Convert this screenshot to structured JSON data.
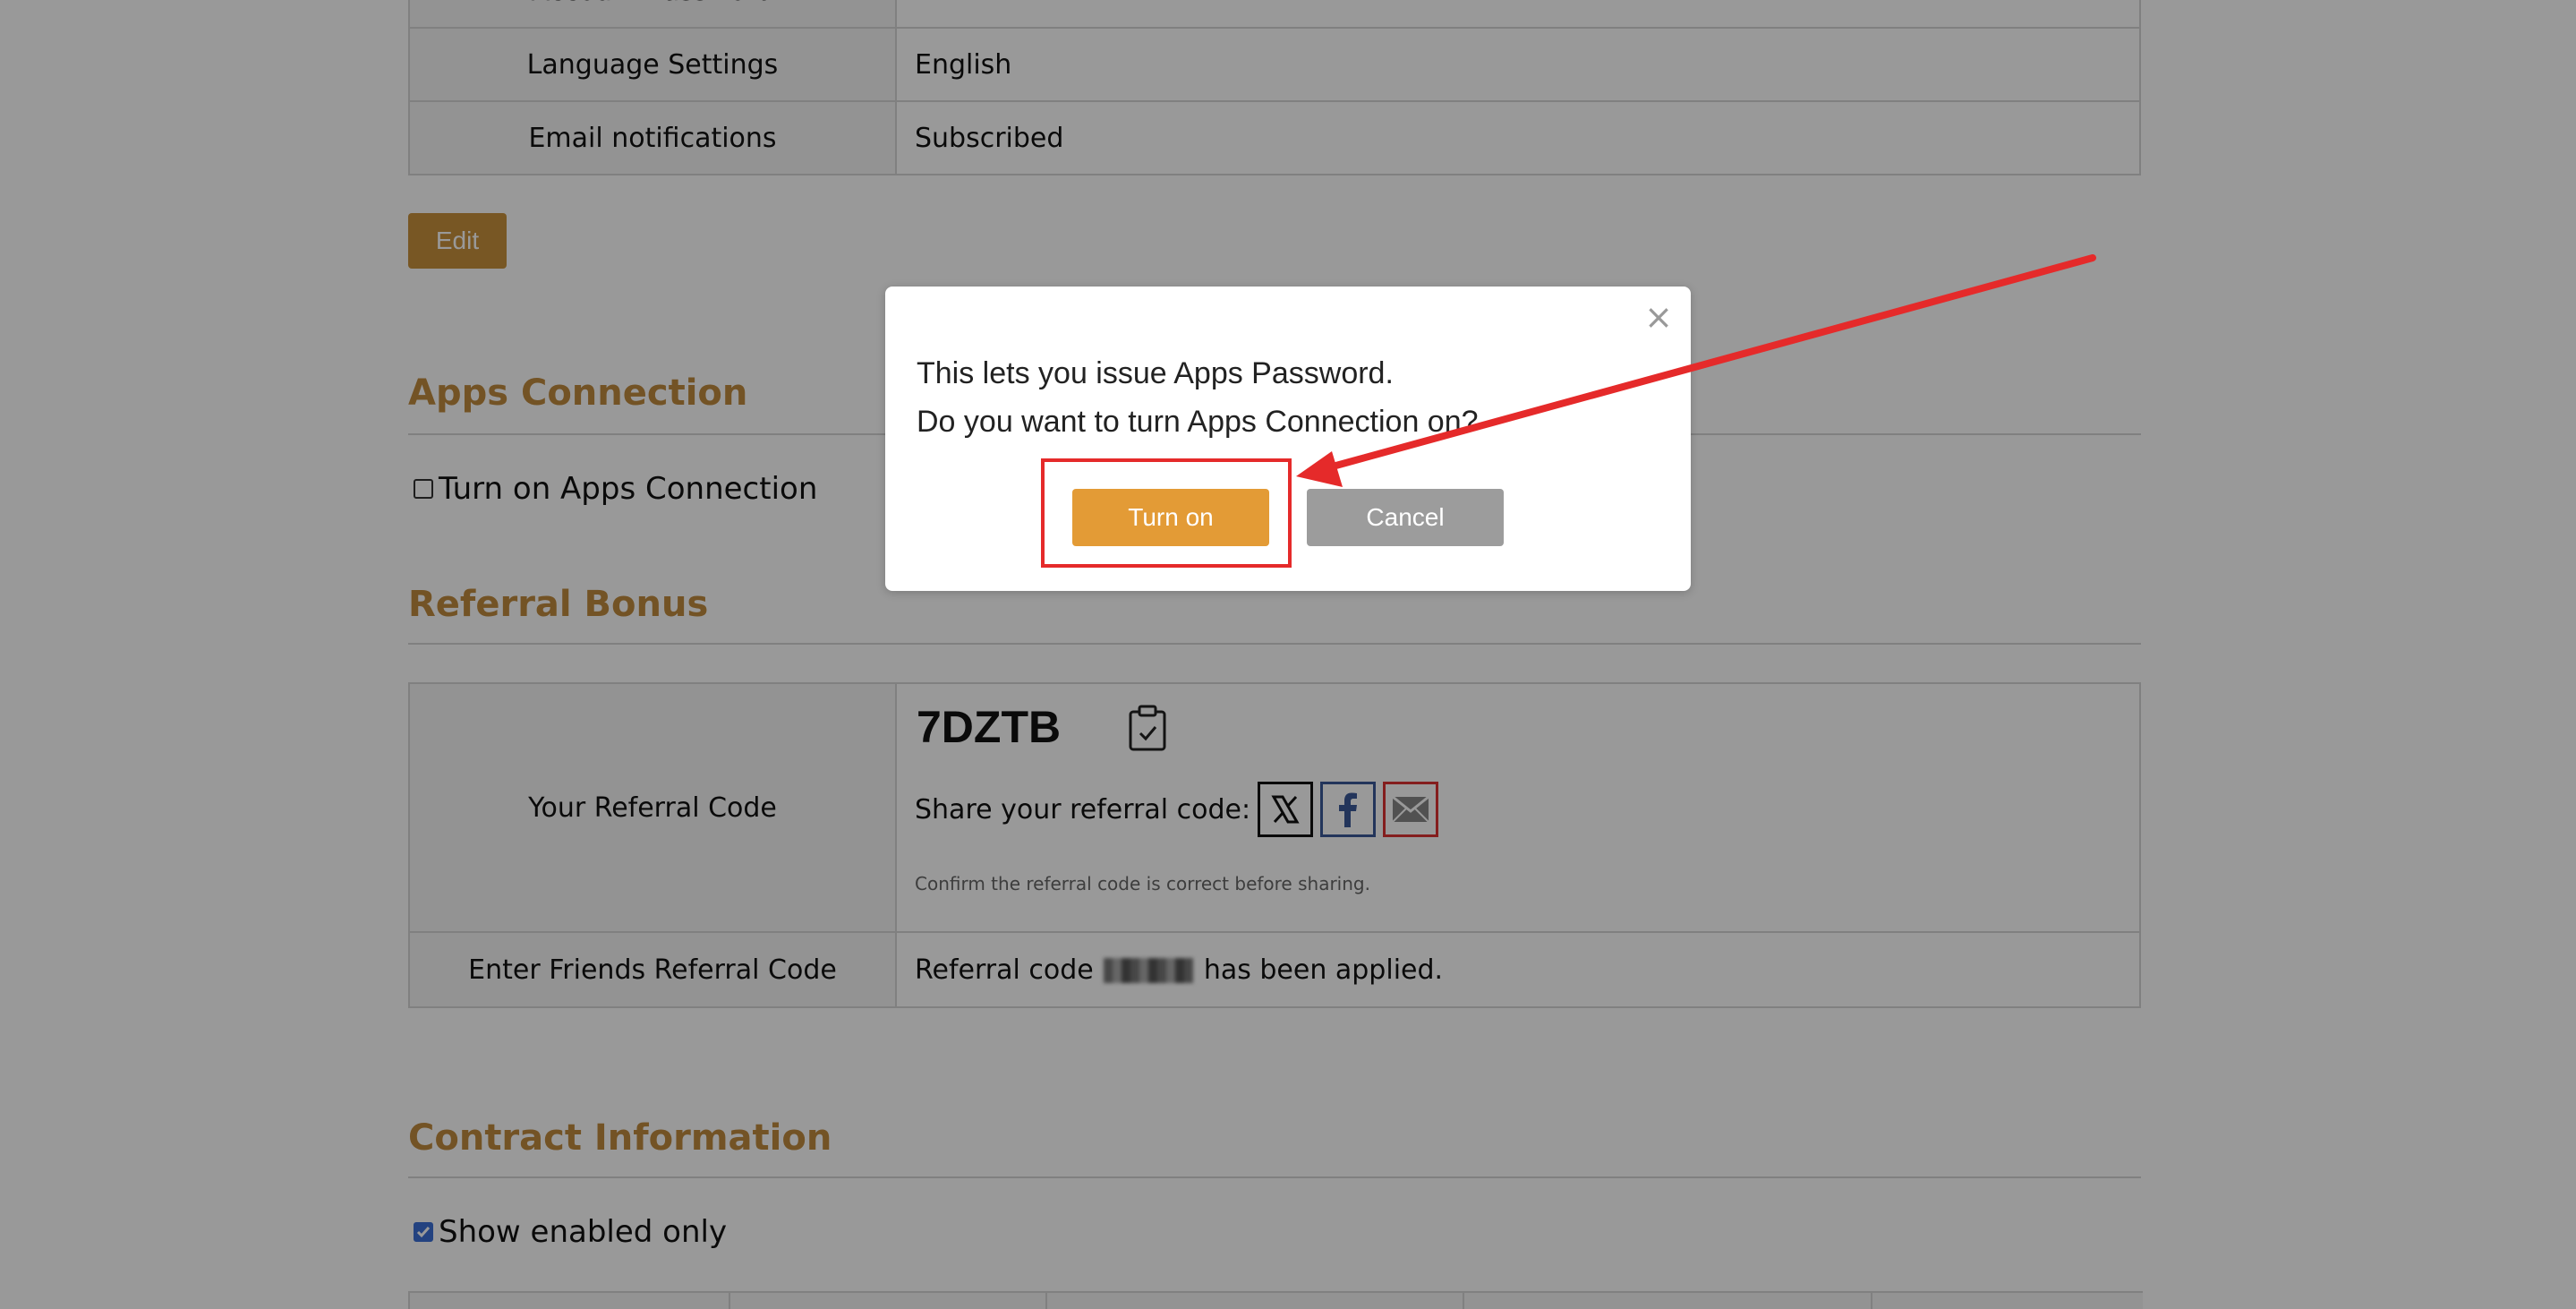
{
  "settings": {
    "rows": [
      {
        "label": "Account Password",
        "value": ""
      },
      {
        "label": "Language Settings",
        "value": "English"
      },
      {
        "label": "Email notifications",
        "value": "Subscribed"
      }
    ],
    "edit_label": "Edit"
  },
  "apps_connection": {
    "title": "Apps Connection",
    "checkbox_label": "Turn on Apps Connection",
    "checked": false
  },
  "referral": {
    "title": "Referral Bonus",
    "your_code_label": "Your Referral Code",
    "code": "7DZTB",
    "share_label": "Share your referral code:",
    "note": "Confirm the referral code is correct before sharing.",
    "friends_label": "Enter Friends Referral Code",
    "applied_prefix": "Referral code",
    "applied_suffix": "has been applied."
  },
  "contract": {
    "title": "Contract Information",
    "checkbox_label": "Show enabled only",
    "checked": true
  },
  "modal": {
    "line1": "This lets you issue Apps Password.",
    "line2": "Do you want to turn Apps Connection on?",
    "confirm_label": "Turn on",
    "cancel_label": "Cancel",
    "close_symbol": "×"
  },
  "colors": {
    "accent": "#c08a3e",
    "turn_on": "#e39b36",
    "cancel": "#9c9c9c",
    "annotation": "#e52a2a"
  },
  "icons": [
    "clipboard-check-icon",
    "x-logo-icon",
    "facebook-icon",
    "mail-icon",
    "close-icon",
    "checkmark-icon"
  ]
}
